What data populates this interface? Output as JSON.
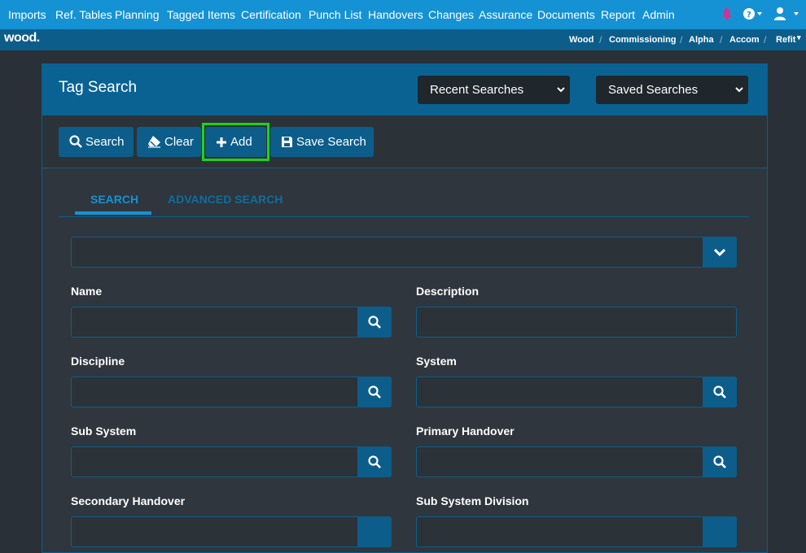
{
  "nav": {
    "items": [
      "Imports",
      "Ref. Tables",
      "Planning",
      "Tagged Items",
      "Certification",
      "Punch List",
      "Handovers",
      "Changes",
      "Assurance",
      "Documents",
      "Report",
      "Admin"
    ]
  },
  "logo": "wood.",
  "breadcrumb": [
    "Wood",
    "Commissioning",
    "Alpha",
    "Accom",
    "Refit"
  ],
  "panel": {
    "title": "Tag Search",
    "recent_searches": "Recent Searches",
    "saved_searches": "Saved Searches"
  },
  "toolbar": {
    "search": "Search",
    "clear": "Clear",
    "add": "Add",
    "save_search": "Save Search"
  },
  "tabs": {
    "search": "SEARCH",
    "advanced": "ADVANCED SEARCH"
  },
  "fields": {
    "name": "Name",
    "description": "Description",
    "discipline": "Discipline",
    "system": "System",
    "sub_system": "Sub System",
    "primary_handover": "Primary Handover",
    "secondary_handover": "Secondary Handover",
    "sub_system_division": "Sub System Division"
  },
  "colors": {
    "nav": "#1592d4",
    "subbar": "#0d5d8a",
    "header": "#0a6293",
    "highlight": "#1ed31a",
    "tab_active": "#1592d4",
    "tab_inactive": "#0d6e9e"
  }
}
